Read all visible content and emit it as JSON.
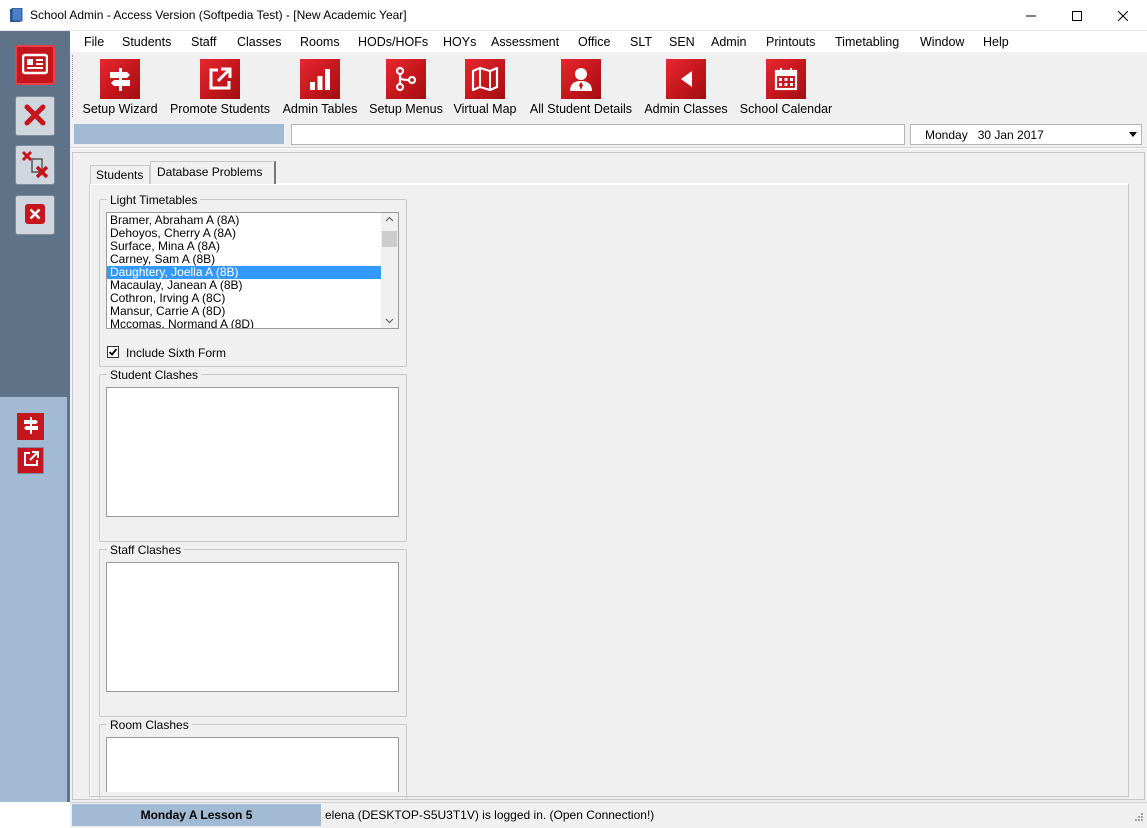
{
  "window": {
    "title": "School Admin - Access Version (Softpedia Test) - [New Academic Year]",
    "minimize_label": "—",
    "maximize_label": "☐",
    "close_label": "✕"
  },
  "menu": [
    "File",
    "Students",
    "Staff",
    "Classes",
    "Rooms",
    "HODs/HOFs",
    "HOYs",
    "Assessment",
    "Office",
    "SLT",
    "SEN",
    "Admin",
    "Printouts",
    "Timetabling",
    "Window",
    "Help"
  ],
  "toolbar": [
    {
      "label": "Setup Wizard",
      "icon": "signpost-icon"
    },
    {
      "label": "Promote Students",
      "icon": "external-link-icon"
    },
    {
      "label": "Admin Tables",
      "icon": "bar-chart-icon"
    },
    {
      "label": "Setup Menus",
      "icon": "branch-icon"
    },
    {
      "label": "Virtual Map",
      "icon": "map-icon"
    },
    {
      "label": "All Student Details",
      "icon": "person-icon"
    },
    {
      "label": "Admin Classes",
      "icon": "back-arrow-icon"
    },
    {
      "label": "School Calendar",
      "icon": "calendar-icon"
    }
  ],
  "date_select": {
    "value": "Monday   30 Jan 2017"
  },
  "tabs": {
    "students": "Students",
    "database_problems": "Database Problems"
  },
  "light_timetables": {
    "label": "Light Timetables",
    "items": [
      "Bramer, Abraham A (8A)",
      "Dehoyos, Cherry A (8A)",
      "Surface, Mina A (8A)",
      "Carney, Sam A (8B)",
      "Daughtery, Joella A (8B)",
      "Macaulay, Janean A (8B)",
      "Cothron, Irving A (8C)",
      "Mansur, Carrie A (8D)",
      "Mccomas, Normand A (8D)"
    ],
    "selected_index": 4,
    "include_sixth_form": "Include Sixth Form",
    "include_sixth_form_checked": true
  },
  "student_clashes": {
    "label": "Student Clashes"
  },
  "staff_clashes": {
    "label": "Staff Clashes"
  },
  "room_clashes": {
    "label": "Room Clashes"
  },
  "status": {
    "lesson": "Monday A Lesson 5",
    "user": "elena (DESKTOP-S5U3T1V) is logged in. (Open Connection!)"
  },
  "colors": {
    "brand_red": "#c4161c",
    "sidebar_dark": "#5e7388",
    "sidebar_light": "#a2bad4",
    "selection": "#3399ff"
  }
}
